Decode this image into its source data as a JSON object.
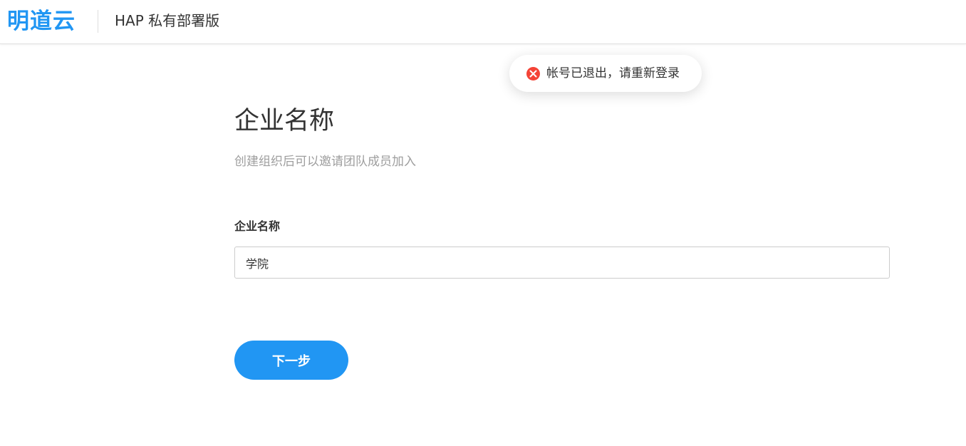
{
  "header": {
    "logo_text": "明道云",
    "edition_text": "HAP 私有部署版"
  },
  "toast": {
    "icon": "error-circle-icon",
    "message": "帐号已退出，请重新登录"
  },
  "main": {
    "title": "企业名称",
    "subtitle": "创建组织后可以邀请团队成员加入",
    "company_name_label": "企业名称",
    "company_name_value": "学院",
    "next_button_label": "下一步"
  },
  "colors": {
    "brand_blue": "#2196f3",
    "error_red": "#f44336",
    "button_blue": "#2196f3"
  }
}
